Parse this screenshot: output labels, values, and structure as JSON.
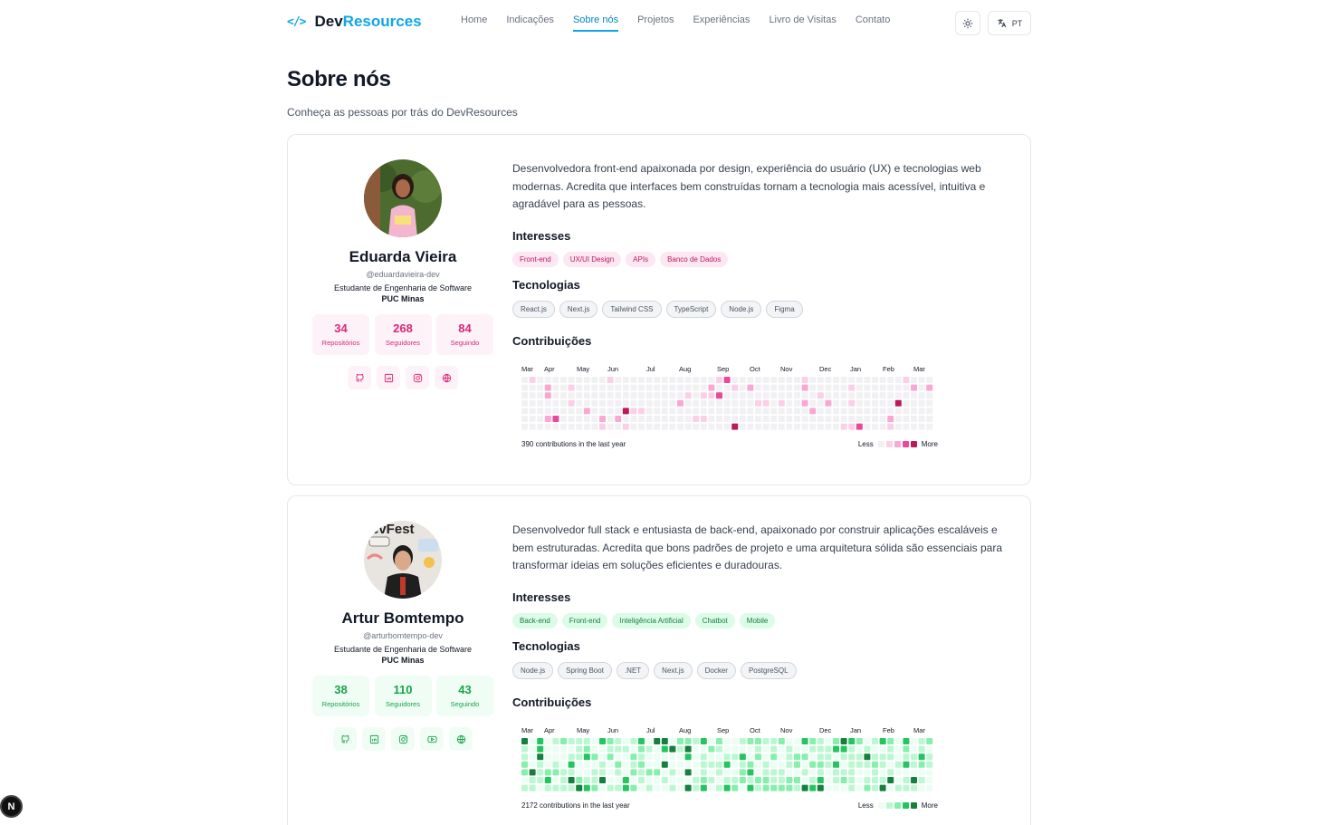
{
  "header": {
    "logo_code": "</>",
    "logo_dev": "Dev",
    "logo_resources": "Resources",
    "nav": [
      {
        "label": "Home",
        "active": false
      },
      {
        "label": "Indicações",
        "active": false
      },
      {
        "label": "Sobre nós",
        "active": true
      },
      {
        "label": "Projetos",
        "active": false
      },
      {
        "label": "Experiências",
        "active": false
      },
      {
        "label": "Livro de Visitas",
        "active": false
      },
      {
        "label": "Contato",
        "active": false
      }
    ],
    "lang_label": "PT"
  },
  "page": {
    "title": "Sobre nós",
    "subtitle": "Conheça as pessoas por trás do DevResources"
  },
  "profiles": [
    {
      "name": "Eduarda Vieira",
      "handle": "@eduardavieira-dev",
      "role": "Estudante de Engenharia de Software",
      "school": "PUC Minas",
      "stats": [
        {
          "value": "34",
          "label": "Repositórios"
        },
        {
          "value": "268",
          "label": "Seguidores"
        },
        {
          "value": "84",
          "label": "Seguindo"
        }
      ],
      "bio": "Desenvolvedora front-end apaixonada por design, experiência do usuário (UX) e tecnologias web modernas. Acredita que interfaces bem construídas tornam a tecnologia mais acessível, intuitiva e agradável para as pessoas.",
      "interests_title": "Interesses",
      "interests": [
        "Front-end",
        "UX/UI Design",
        "APIs",
        "Banco de Dados"
      ],
      "tech_title": "Tecnologias",
      "technologies": [
        "React.js",
        "Next.js",
        "Tailwind CSS",
        "TypeScript",
        "Node.js",
        "Figma"
      ],
      "contrib_title": "Contribuições",
      "contrib_summary": "390 contributions in the last year",
      "theme": "pink",
      "palette": [
        "#f1f1f3",
        "#fbcfe8",
        "#f9a8d4",
        "#ec4899",
        "#be185d"
      ],
      "socials": [
        "github-icon",
        "linkedin-icon",
        "instagram-icon",
        "globe-icon"
      ]
    },
    {
      "name": "Artur Bomtempo",
      "handle": "@arturbomtempo-dev",
      "role": "Estudante de Engenharia de Software",
      "school": "PUC Minas",
      "stats": [
        {
          "value": "38",
          "label": "Repositórios"
        },
        {
          "value": "110",
          "label": "Seguidores"
        },
        {
          "value": "43",
          "label": "Seguindo"
        }
      ],
      "bio": "Desenvolvedor full stack e entusiasta de back-end, apaixonado por construir aplicações escaláveis e bem estruturadas. Acredita que bons padrões de projeto e uma arquitetura sólida são essenciais para transformar ideias em soluções eficientes e duradouras.",
      "interests_title": "Interesses",
      "interests": [
        "Back-end",
        "Front-end",
        "Inteligência Artificial",
        "Chatbot",
        "Mobile"
      ],
      "tech_title": "Tecnologias",
      "technologies": [
        "Node.js",
        "Spring Boot",
        ".NET",
        "Next.js",
        "Docker",
        "PostgreSQL"
      ],
      "contrib_title": "Contribuições",
      "contrib_summary": "2172 contributions in the last year",
      "theme": "green",
      "palette": [
        "#ecfdf3",
        "#bbf7d0",
        "#86efac",
        "#22c55e",
        "#15803d"
      ],
      "socials": [
        "github-icon",
        "linkedin-icon",
        "instagram-icon",
        "youtube-icon",
        "globe-icon"
      ]
    }
  ],
  "graph": {
    "months": [
      "Mar",
      "Apr",
      "May",
      "Jun",
      "Jul",
      "Aug",
      "Sep",
      "Oct",
      "Nov",
      "Dec",
      "Jan",
      "Feb",
      "Mar"
    ],
    "less_label": "Less",
    "more_label": "More"
  },
  "fab_label": "N"
}
